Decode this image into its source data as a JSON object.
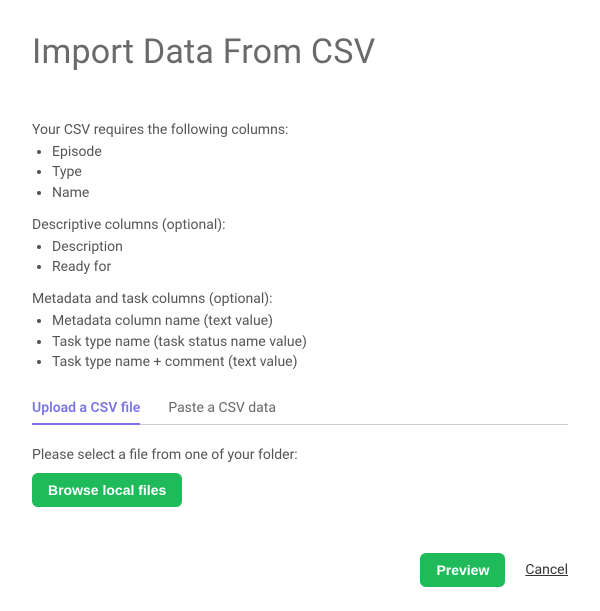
{
  "title": "Import Data From CSV",
  "sections": {
    "required": {
      "label": "Your CSV requires the following columns:",
      "items": [
        "Episode",
        "Type",
        "Name"
      ]
    },
    "descriptive": {
      "label": "Descriptive columns (optional):",
      "items": [
        "Description",
        "Ready for"
      ]
    },
    "metadata": {
      "label": "Metadata and task columns (optional):",
      "items": [
        "Metadata column name (text value)",
        "Task type name (task status name value)",
        "Task type name + comment (text value)"
      ]
    }
  },
  "tabs": {
    "upload": "Upload a CSV file",
    "paste": "Paste a CSV data"
  },
  "file_select": {
    "label": "Please select a file from one of your folder:",
    "browse_button": "Browse local files"
  },
  "footer": {
    "preview_button": "Preview",
    "cancel_link": "Cancel"
  },
  "colors": {
    "accent": "#7b75e6",
    "primary": "#1fbb5a"
  }
}
